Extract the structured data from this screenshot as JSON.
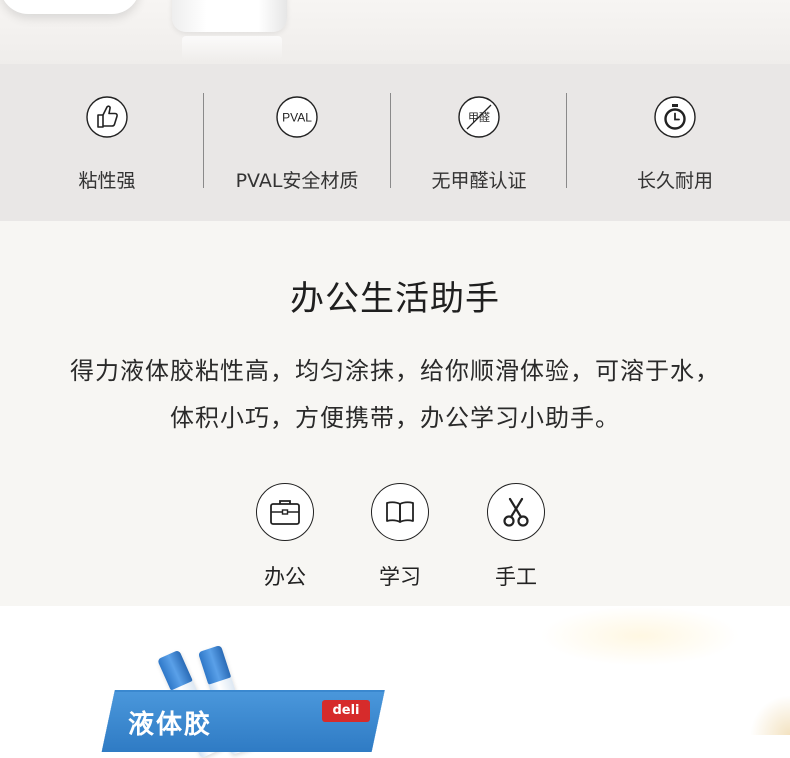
{
  "features": [
    {
      "icon": "thumbs-up-icon",
      "label": "粘性强"
    },
    {
      "icon": "pval-badge-icon",
      "label": "PVAL安全材质",
      "badge_text": "PVAL"
    },
    {
      "icon": "no-formaldehyde-icon",
      "label": "无甲醛认证",
      "badge_text": "甲醛"
    },
    {
      "icon": "stopwatch-icon",
      "label": "长久耐用"
    }
  ],
  "middle": {
    "title": "办公生活助手",
    "desc_line1": "得力液体胶粘性高，均匀涂抹，给你顺滑体验，可溶于水，",
    "desc_line2": "体积小巧，方便携带，办公学习小助手。"
  },
  "uses": [
    {
      "icon": "briefcase-icon",
      "label": "办公"
    },
    {
      "icon": "open-book-icon",
      "label": "学习"
    },
    {
      "icon": "scissors-icon",
      "label": "手工"
    }
  ],
  "product": {
    "box_text": "液体胶",
    "brand": "deli"
  },
  "colors": {
    "feature_bg": "#e9e7e6",
    "middle_bg": "#f7f6f3",
    "brand_blue": "#2f7bc4",
    "brand_red": "#d62b2b"
  }
}
